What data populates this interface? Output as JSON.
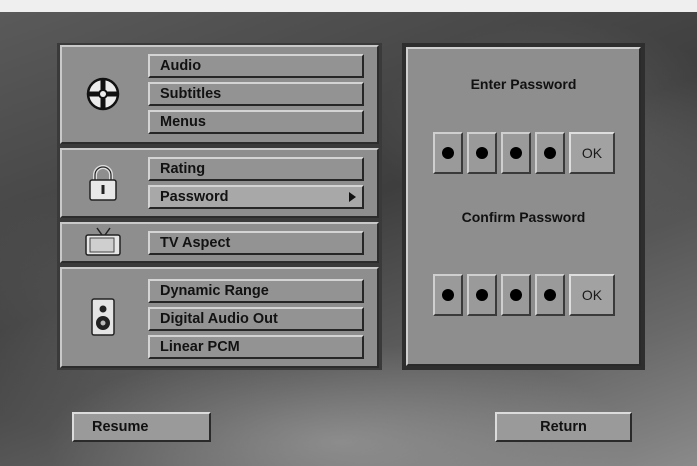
{
  "menu": {
    "groups": [
      {
        "icon": "disc-icon",
        "items": [
          "Audio",
          "Subtitles",
          "Menus"
        ]
      },
      {
        "icon": "lock-icon",
        "items": [
          "Rating",
          "Password"
        ]
      },
      {
        "icon": "tv-icon",
        "items": [
          "TV Aspect"
        ]
      },
      {
        "icon": "speaker-icon",
        "items": [
          "Dynamic Range",
          "Digital Audio Out",
          "Linear PCM"
        ]
      }
    ],
    "selected_item": "Password"
  },
  "password_panel": {
    "enter_title": "Enter Password",
    "confirm_title": "Confirm Password",
    "ok_label": "OK",
    "digits_entered": 4
  },
  "buttons": {
    "resume": "Resume",
    "return": "Return"
  }
}
